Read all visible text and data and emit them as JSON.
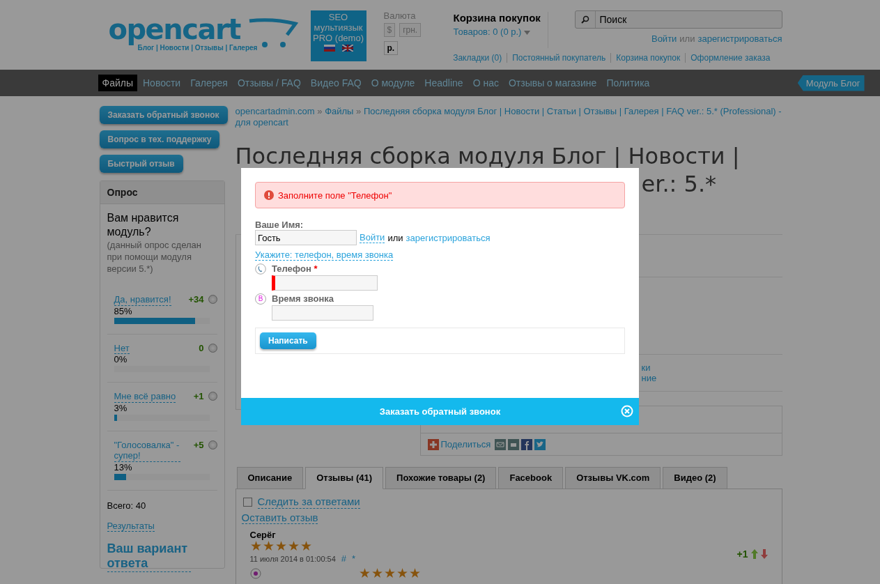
{
  "header": {
    "logo": {
      "name": "opencart",
      "tagline": "Блог | Новости | Отзывы | Галерея"
    },
    "promo": {
      "text": "SEO мультиязык PRO (demo)"
    },
    "currency": {
      "label": "Валюта",
      "options": [
        {
          "label": "$",
          "selected": false
        },
        {
          "label": "грн.",
          "selected": false
        },
        {
          "label": "р.",
          "selected": true
        }
      ]
    },
    "cart": {
      "title": "Корзина покупок",
      "summary": "Товаров: 0 (0 р.)"
    },
    "search": {
      "placeholder": "Поиск"
    },
    "account": {
      "login": "Войти",
      "or": "или",
      "register": "зарегистрироваться"
    },
    "top_links": [
      "Закладки (0)",
      "Постоянный покупатель",
      "Корзина покупок",
      "Оформление заказа"
    ]
  },
  "nav": {
    "items": [
      {
        "label": "Файлы",
        "selected": true
      },
      {
        "label": "Новости",
        "selected": false
      },
      {
        "label": "Галерея",
        "selected": false
      },
      {
        "label": "Отзывы / FAQ",
        "selected": false
      },
      {
        "label": "Видео FAQ",
        "selected": false
      },
      {
        "label": "О модуле",
        "selected": false
      },
      {
        "label": "Headline",
        "selected": false
      },
      {
        "label": "О нас",
        "selected": false
      },
      {
        "label": "Отзывы о магазине",
        "selected": false
      },
      {
        "label": "Политика",
        "selected": false
      }
    ],
    "tag": "Модуль Блог"
  },
  "sidebar": {
    "buttons": [
      "Заказать обратный звонок",
      "Вопрос в тех. поддержку",
      "Быстрый отзыв"
    ],
    "poll": {
      "title": "Опрос",
      "question": "Вам нравится модуль?",
      "note": "(данный опрос сделан при помощи модуля версии 5.*)",
      "options": [
        {
          "label": "Да, нравится!",
          "count": "+34",
          "percent": "85%",
          "level": 0.85,
          "selected": false
        },
        {
          "label": "Нет",
          "count": "0",
          "percent": "0%",
          "selected": false
        },
        {
          "label": "Мне всё равно",
          "count": "+1",
          "percent": "3%",
          "level": 0.03,
          "selected": false
        },
        {
          "label": "\"Голосовалка\" - супер!",
          "count": "+5",
          "percent": "13%",
          "level": 0.13,
          "selected": false
        }
      ],
      "total": "Всего: 40",
      "results": "Результаты",
      "own_answer": "Ваш вариант ответа"
    }
  },
  "breadcrumb": {
    "separator": "»",
    "items": [
      "opencartadmin.com",
      "Файлы",
      "Последняя сборка модуля Блог | Новости | Статьи | Отзывы | Галерея | FAQ ver.: 5.* (Professional) - для opencart"
    ]
  },
  "title": {
    "line_1": "Последняя сборка модуля Блог | Новости |",
    "line_2_visible": "er.: 5.*"
  },
  "product_info": {
    "visible_fragments": [
      "ки",
      "ние"
    ],
    "share": "Поделиться"
  },
  "tabs": [
    {
      "label": "Описание",
      "selected": false
    },
    {
      "label": "Отзывы (41)",
      "selected": true
    },
    {
      "label": "Похожие товары (2)",
      "selected": false
    },
    {
      "label": "Facebook",
      "selected": false
    },
    {
      "label": "Отзывы VK.com",
      "selected": false
    },
    {
      "label": "Видео (2)",
      "selected": false
    }
  ],
  "reviews": {
    "follow": {
      "label": "Следить за ответами",
      "checked": false
    },
    "leave": "Оставить отзыв",
    "items": [
      {
        "author": "Серёг",
        "stars": 5,
        "date": "11 июля 2014 в 01:00:54",
        "anchor": "#",
        "mark": "*",
        "score": "+1",
        "second_rating": {
          "stars": 5
        }
      }
    ]
  },
  "modal": {
    "error": "Заполните поле \"Телефон\"",
    "name_label": "Ваше Имя:",
    "name_value": "Гость",
    "login": "Войти",
    "or": "или",
    "register": "зарегистрироваться",
    "hint": "Укажите: телефон, время звонка",
    "fields": [
      {
        "kind": "phone",
        "label": "Телефон",
        "required": true,
        "error": true
      },
      {
        "kind": "time",
        "label": "Время звонка",
        "badge": "B",
        "required": false,
        "error": false
      }
    ],
    "submit": "Написать",
    "title": "Заказать обратный звонок"
  }
}
